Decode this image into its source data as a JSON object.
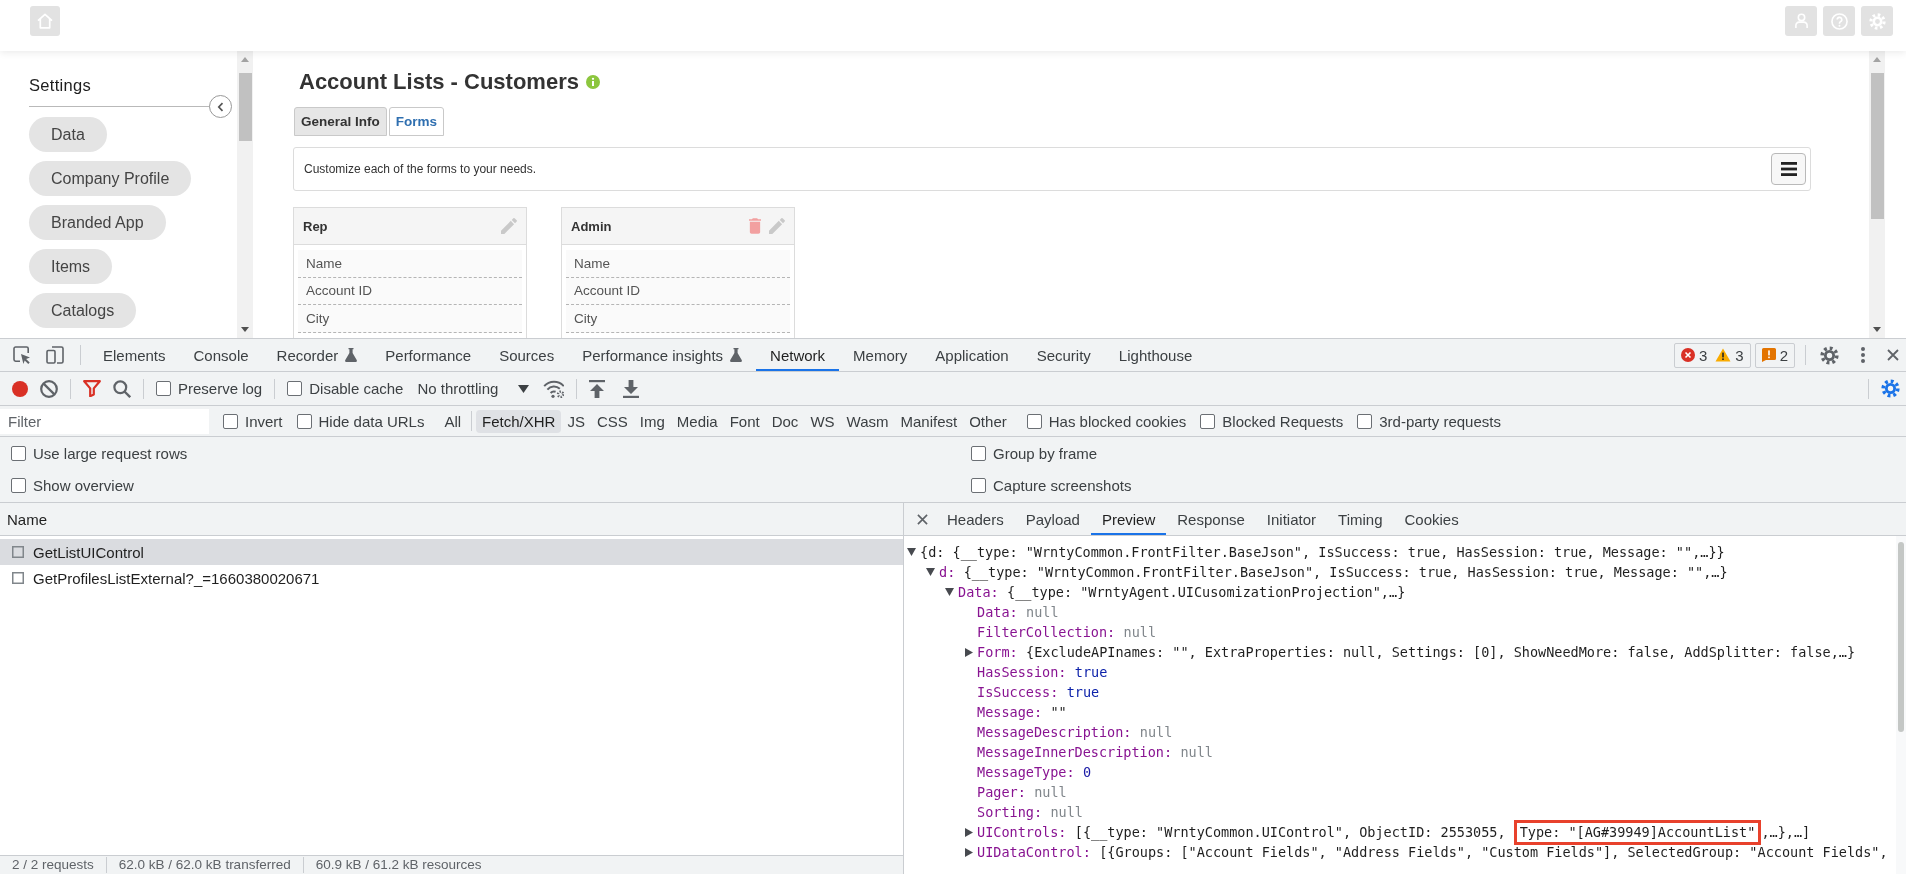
{
  "sidebar": {
    "title": "Settings",
    "items": [
      {
        "label": "Data"
      },
      {
        "label": "Company Profile"
      },
      {
        "label": "Branded App"
      },
      {
        "label": "Items"
      },
      {
        "label": "Catalogs"
      }
    ]
  },
  "page": {
    "title": "Account Lists - Customers",
    "tabs": [
      {
        "label": "General Info",
        "selected": false
      },
      {
        "label": "Forms",
        "selected": true
      }
    ],
    "description": "Customize each of the forms to your needs.",
    "forms": [
      {
        "title": "Rep",
        "deletable": false,
        "fields": [
          "Name",
          "Account ID",
          "City"
        ]
      },
      {
        "title": "Admin",
        "deletable": true,
        "fields": [
          "Name",
          "Account ID",
          "City"
        ]
      }
    ]
  },
  "devtools": {
    "panel_tabs": [
      {
        "label": "Elements",
        "selected": false,
        "experimental": false
      },
      {
        "label": "Console",
        "selected": false,
        "experimental": false
      },
      {
        "label": "Recorder",
        "selected": false,
        "experimental": true
      },
      {
        "label": "Performance",
        "selected": false,
        "experimental": false
      },
      {
        "label": "Sources",
        "selected": false,
        "experimental": false
      },
      {
        "label": "Performance insights",
        "selected": false,
        "experimental": true
      },
      {
        "label": "Network",
        "selected": true,
        "experimental": false
      },
      {
        "label": "Memory",
        "selected": false,
        "experimental": false
      },
      {
        "label": "Application",
        "selected": false,
        "experimental": false
      },
      {
        "label": "Security",
        "selected": false,
        "experimental": false
      },
      {
        "label": "Lighthouse",
        "selected": false,
        "experimental": false
      }
    ],
    "errors": "3",
    "warnings": "3",
    "issues": "2",
    "toolbar": {
      "recording": true,
      "filter_open": true,
      "checkboxes": [
        {
          "label": "Preserve log",
          "checked": false
        },
        {
          "label": "Disable cache",
          "checked": false
        }
      ],
      "throttling": "No throttling"
    },
    "filter_bar": {
      "placeholder": "Filter",
      "options": [
        {
          "label": "Invert",
          "checked": false
        },
        {
          "label": "Hide data URLs",
          "checked": false
        }
      ],
      "types": [
        {
          "label": "All",
          "selected": false
        },
        {
          "label": "Fetch/XHR",
          "selected": true
        },
        {
          "label": "JS",
          "selected": false
        },
        {
          "label": "CSS",
          "selected": false
        },
        {
          "label": "Img",
          "selected": false
        },
        {
          "label": "Media",
          "selected": false
        },
        {
          "label": "Font",
          "selected": false
        },
        {
          "label": "Doc",
          "selected": false
        },
        {
          "label": "WS",
          "selected": false
        },
        {
          "label": "Wasm",
          "selected": false
        },
        {
          "label": "Manifest",
          "selected": false
        },
        {
          "label": "Other",
          "selected": false
        }
      ],
      "extra_options": [
        {
          "label": "Has blocked cookies",
          "checked": false
        },
        {
          "label": "Blocked Requests",
          "checked": false
        },
        {
          "label": "3rd-party requests",
          "checked": false
        }
      ]
    },
    "settings": {
      "left": [
        {
          "label": "Use large request rows",
          "checked": false
        },
        {
          "label": "Show overview",
          "checked": false
        }
      ],
      "right": [
        {
          "label": "Group by frame",
          "checked": false
        },
        {
          "label": "Capture screenshots",
          "checked": false
        }
      ]
    },
    "requests": {
      "column": "Name",
      "rows": [
        {
          "name": "GetListUIControl",
          "selected": true
        },
        {
          "name": "GetProfilesListExternal?_=1660380020671",
          "selected": false
        }
      ],
      "status": [
        "2 / 2 requests",
        "62.0 kB / 62.0 kB transferred",
        "60.9 kB / 61.2 kB resources"
      ]
    },
    "detail_tabs": [
      {
        "label": "Headers",
        "selected": false
      },
      {
        "label": "Payload",
        "selected": false
      },
      {
        "label": "Preview",
        "selected": true
      },
      {
        "label": "Response",
        "selected": false
      },
      {
        "label": "Initiator",
        "selected": false
      },
      {
        "label": "Timing",
        "selected": false
      },
      {
        "label": "Cookies",
        "selected": false
      }
    ],
    "preview": {
      "root": {
        "value": "{d: {__type: \"WrntyCommon.FrontFilter.BaseJson\", IsSuccess: true, HasSession: true, Message: \"\",…}}",
        "kind": "object",
        "expanded": true,
        "children": [
          {
            "key": "d:",
            "value": "{__type: \"WrntyCommon.FrontFilter.BaseJson\", IsSuccess: true, HasSession: true, Message: \"\",…}",
            "kind": "object",
            "expanded": true,
            "children": [
              {
                "key": "Data:",
                "value": "{__type: \"WrntyAgent.UICusomizationProjection\",…}",
                "kind": "object",
                "expanded": true,
                "children": [
                  {
                    "key": "Data:",
                    "value": "null",
                    "kind": "null"
                  },
                  {
                    "key": "FilterCollection:",
                    "value": "null",
                    "kind": "null"
                  },
                  {
                    "key": "Form:",
                    "value": "{ExcludeAPInames: \"\", ExtraProperties: null, Settings: [0], ShowNeedMore: false, AddSplitter: false,…}",
                    "kind": "object",
                    "expanded": false
                  },
                  {
                    "key": "HasSession:",
                    "value": "true",
                    "kind": "boolean"
                  },
                  {
                    "key": "IsSuccess:",
                    "value": "true",
                    "kind": "boolean"
                  },
                  {
                    "key": "Message:",
                    "value": "\"\"",
                    "kind": "string"
                  },
                  {
                    "key": "MessageDescription:",
                    "value": "null",
                    "kind": "null"
                  },
                  {
                    "key": "MessageInnerDescription:",
                    "value": "null",
                    "kind": "null"
                  },
                  {
                    "key": "MessageType:",
                    "value": "0",
                    "kind": "number"
                  },
                  {
                    "key": "Pager:",
                    "value": "null",
                    "kind": "null"
                  },
                  {
                    "key": "Sorting:",
                    "value": "null",
                    "kind": "null"
                  },
                  {
                    "key": "UIControls:",
                    "kind": "object",
                    "expanded": false,
                    "value_parts": [
                      {
                        "text": "[{__type: \"WrntyCommon.UIControl\", ObjectID: 2553055, ",
                        "highlighted": false
                      },
                      {
                        "text": "Type: \"[AG#39949]AccountList\"",
                        "highlighted": true
                      },
                      {
                        "text": ",…},…]",
                        "highlighted": false
                      }
                    ]
                  },
                  {
                    "key": "UIDataControl:",
                    "value": "[{Groups: [\"Account Fields\", \"Address Fields\", \"Custom Fields\"], SelectedGroup: \"Account Fields\",",
                    "kind": "object",
                    "expanded": false
                  }
                ]
              }
            ]
          }
        ]
      }
    }
  }
}
